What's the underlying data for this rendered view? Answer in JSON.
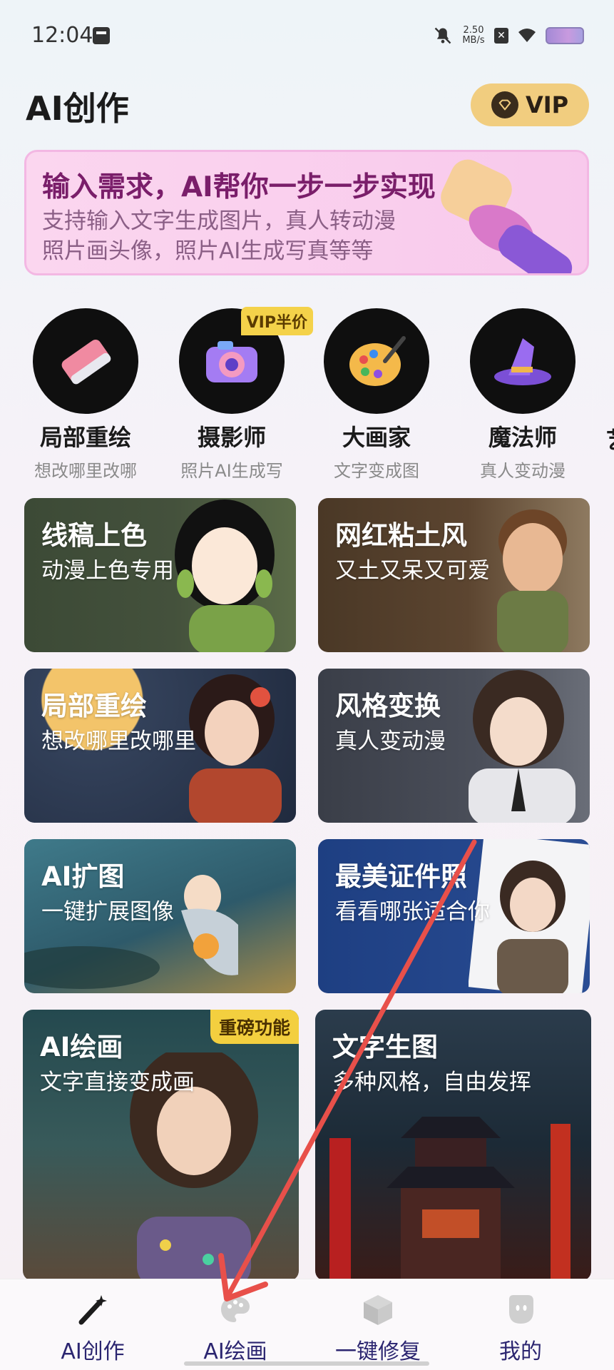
{
  "status_bar": {
    "time": "12:04",
    "net_speed_value": "2.50",
    "net_speed_unit": "MB/s"
  },
  "header": {
    "title": "AI创作",
    "vip_label": "VIP"
  },
  "banner": {
    "title": "输入需求，AI帮你一步一步实现",
    "subtitle_line1": "支持输入文字生成图片，真人转动漫",
    "subtitle_line2": "照片画头像，照片AI生成写真等等"
  },
  "features": [
    {
      "label": "局部重绘",
      "sub": "想改哪里改哪",
      "icon": "eraser-icon"
    },
    {
      "label": "摄影师",
      "sub": "照片AI生成写",
      "icon": "camera-icon",
      "badge": "VIP半价"
    },
    {
      "label": "大画家",
      "sub": "文字变成图",
      "icon": "palette-icon"
    },
    {
      "label": "魔法师",
      "sub": "真人变动漫",
      "icon": "wizard-hat-icon"
    }
  ],
  "feature_edge_char": "艺",
  "cards": [
    {
      "title": "线稿上色",
      "sub": "动漫上色专用"
    },
    {
      "title": "网红粘土风",
      "sub": "又土又呆又可爱"
    },
    {
      "title": "局部重绘",
      "sub": "想改哪里改哪里"
    },
    {
      "title": "风格变换",
      "sub": "真人变动漫"
    },
    {
      "title": "AI扩图",
      "sub": "一键扩展图像"
    },
    {
      "title": "最美证件照",
      "sub": "看看哪张适合你"
    },
    {
      "title": "AI绘画",
      "sub": "文字直接变成画",
      "badge": "重磅功能"
    },
    {
      "title": "文字生图",
      "sub": "多种风格，自由发挥"
    }
  ],
  "bottom_nav": [
    {
      "label": "AI创作",
      "icon": "magic-wand-icon"
    },
    {
      "label": "AI绘画",
      "icon": "palette-icon"
    },
    {
      "label": "一键修复",
      "icon": "cube-icon"
    },
    {
      "label": "我的",
      "icon": "profile-icon"
    }
  ],
  "colors": {
    "accent_vip": "#f1cd7f",
    "banner_title": "#7a1e6a",
    "nav_text": "#2b2570",
    "annotation_arrow": "#e8504a"
  }
}
